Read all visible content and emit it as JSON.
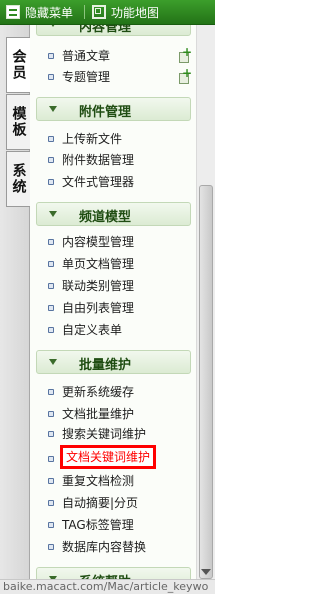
{
  "toolbar": {
    "hide_menu_label": "隐藏菜单",
    "sitemap_label": "功能地图"
  },
  "left_tabs": [
    {
      "label": "会员"
    },
    {
      "label": "模板"
    },
    {
      "label": "系统"
    }
  ],
  "sections": {
    "content": {
      "title": "内容管理",
      "items": [
        "普通文章",
        "专题管理"
      ]
    },
    "attachment": {
      "title": "附件管理",
      "items": [
        "上传新文件",
        "附件数据管理",
        "文件式管理器"
      ]
    },
    "channel": {
      "title": "频道模型",
      "items": [
        "内容模型管理",
        "单页文档管理",
        "联动类别管理",
        "自由列表管理",
        "自定义表单"
      ]
    },
    "batch": {
      "title": "批量维护",
      "items": [
        "更新系统缓存",
        "文档批量维护",
        "搜索关键词维护",
        "文档关键词维护",
        "重复文档检测",
        "自动摘要|分页",
        "TAG标签管理",
        "数据库内容替换"
      ]
    },
    "system_help": {
      "title": "系统帮助"
    }
  },
  "status_bar": {
    "text": "baike.macact.com/Mac/article_keywo"
  }
}
